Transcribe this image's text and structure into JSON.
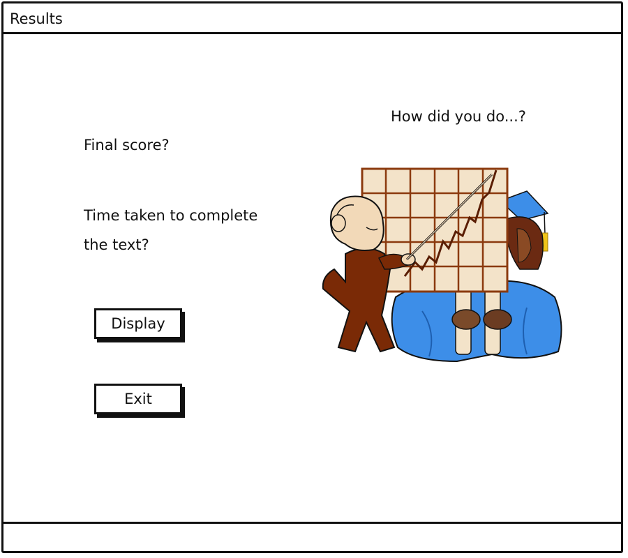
{
  "window": {
    "title": "Results"
  },
  "main": {
    "final_score_label": "Final score?",
    "time_taken_line1": "Time taken to complete",
    "time_taken_line2": "the text?",
    "how_did_you_do": "How did you do...?",
    "illustration_icon": "clipart-teacher-chart-graduate"
  },
  "buttons": {
    "display_label": "Display",
    "exit_label": "Exit"
  },
  "colors": {
    "border": "#111111",
    "background": "#ffffff",
    "chart_fill": "#f3e3c9",
    "chart_line": "#8b3a0e",
    "teacher_suit": "#7a2a06",
    "gown_blue": "#3d8ee8",
    "tassel": "#f0c419"
  }
}
